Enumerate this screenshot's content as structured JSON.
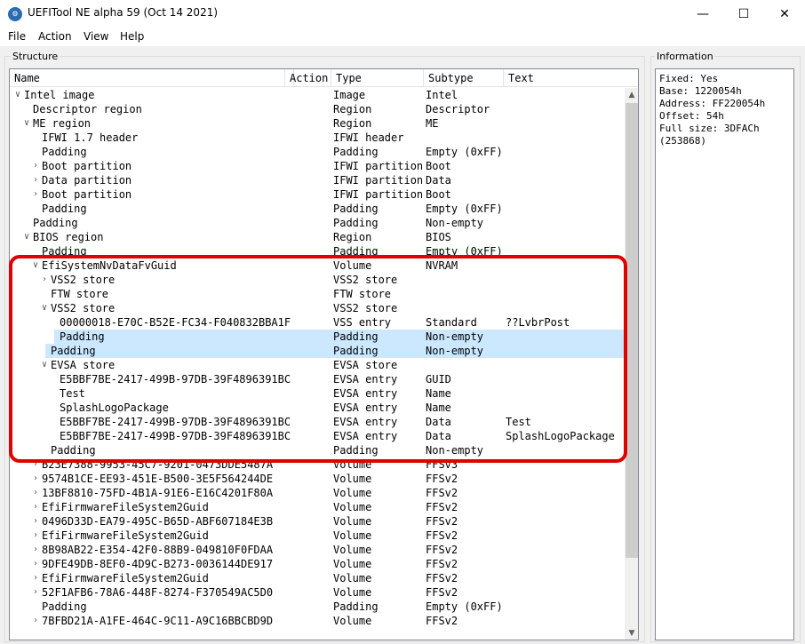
{
  "window": {
    "title": "UEFITool NE alpha 59 (Oct 14 2021)",
    "app_icon_glyph": "⚙",
    "minimize_glyph": "—",
    "maximize_glyph": "☐",
    "close_glyph": "✕"
  },
  "menu": [
    "File",
    "Action",
    "View",
    "Help"
  ],
  "structure": {
    "label": "Structure",
    "columns": [
      "Name",
      "Action",
      "Type",
      "Subtype",
      "Text"
    ],
    "rows": [
      {
        "name": "Intel image",
        "action": "",
        "type": "Image",
        "subtype": "Intel",
        "text": "",
        "depth": 0,
        "expander": "v",
        "selected": false
      },
      {
        "name": "Descriptor region",
        "action": "",
        "type": "Region",
        "subtype": "Descriptor",
        "text": "",
        "depth": 1,
        "expander": "",
        "selected": false
      },
      {
        "name": "ME region",
        "action": "",
        "type": "Region",
        "subtype": "ME",
        "text": "",
        "depth": 1,
        "expander": "v",
        "selected": false
      },
      {
        "name": "IFWI 1.7 header",
        "action": "",
        "type": "IFWI header",
        "subtype": "",
        "text": "",
        "depth": 2,
        "expander": "",
        "selected": false
      },
      {
        "name": "Padding",
        "action": "",
        "type": "Padding",
        "subtype": "Empty (0xFF)",
        "text": "",
        "depth": 2,
        "expander": "",
        "selected": false
      },
      {
        "name": "Boot partition",
        "action": "",
        "type": "IFWI partition",
        "subtype": "Boot",
        "text": "",
        "depth": 2,
        "expander": ">",
        "selected": false
      },
      {
        "name": "Data partition",
        "action": "",
        "type": "IFWI partition",
        "subtype": "Data",
        "text": "",
        "depth": 2,
        "expander": ">",
        "selected": false
      },
      {
        "name": "Boot partition",
        "action": "",
        "type": "IFWI partition",
        "subtype": "Boot",
        "text": "",
        "depth": 2,
        "expander": ">",
        "selected": false
      },
      {
        "name": "Padding",
        "action": "",
        "type": "Padding",
        "subtype": "Empty (0xFF)",
        "text": "",
        "depth": 2,
        "expander": "",
        "selected": false
      },
      {
        "name": "Padding",
        "action": "",
        "type": "Padding",
        "subtype": "Non-empty",
        "text": "",
        "depth": 1,
        "expander": "",
        "selected": false
      },
      {
        "name": "BIOS region",
        "action": "",
        "type": "Region",
        "subtype": "BIOS",
        "text": "",
        "depth": 1,
        "expander": "v",
        "selected": false
      },
      {
        "name": "Padding",
        "action": "",
        "type": "Padding",
        "subtype": "Empty (0xFF)",
        "text": "",
        "depth": 2,
        "expander": "",
        "selected": false
      },
      {
        "name": "EfiSystemNvDataFvGuid",
        "action": "",
        "type": "Volume",
        "subtype": "NVRAM",
        "text": "",
        "depth": 2,
        "expander": "v",
        "selected": false
      },
      {
        "name": "VSS2 store",
        "action": "",
        "type": "VSS2 store",
        "subtype": "",
        "text": "",
        "depth": 3,
        "expander": ">",
        "selected": false
      },
      {
        "name": "FTW store",
        "action": "",
        "type": "FTW store",
        "subtype": "",
        "text": "",
        "depth": 3,
        "expander": "",
        "selected": false
      },
      {
        "name": "VSS2 store",
        "action": "",
        "type": "VSS2 store",
        "subtype": "",
        "text": "",
        "depth": 3,
        "expander": "v",
        "selected": false
      },
      {
        "name": "00000018-E70C-B52E-FC34-F040832BBA1F",
        "action": "",
        "type": "VSS entry",
        "subtype": "Standard",
        "text": "??LvbrPost",
        "depth": 4,
        "expander": "",
        "selected": false
      },
      {
        "name": "Padding",
        "action": "",
        "type": "Padding",
        "subtype": "Non-empty",
        "text": "",
        "depth": 4,
        "expander": "",
        "selected": true
      },
      {
        "name": "Padding",
        "action": "",
        "type": "Padding",
        "subtype": "Non-empty",
        "text": "",
        "depth": 3,
        "expander": "",
        "selected": true
      },
      {
        "name": "EVSA store",
        "action": "",
        "type": "EVSA store",
        "subtype": "",
        "text": "",
        "depth": 3,
        "expander": "v",
        "selected": false
      },
      {
        "name": "E5BBF7BE-2417-499B-97DB-39F4896391BC",
        "action": "",
        "type": "EVSA entry",
        "subtype": "GUID",
        "text": "",
        "depth": 4,
        "expander": "",
        "selected": false
      },
      {
        "name": "Test",
        "action": "",
        "type": "EVSA entry",
        "subtype": "Name",
        "text": "",
        "depth": 4,
        "expander": "",
        "selected": false
      },
      {
        "name": "SplashLogoPackage",
        "action": "",
        "type": "EVSA entry",
        "subtype": "Name",
        "text": "",
        "depth": 4,
        "expander": "",
        "selected": false
      },
      {
        "name": "E5BBF7BE-2417-499B-97DB-39F4896391BC",
        "action": "",
        "type": "EVSA entry",
        "subtype": "Data",
        "text": "Test",
        "depth": 4,
        "expander": "",
        "selected": false
      },
      {
        "name": "E5BBF7BE-2417-499B-97DB-39F4896391BC",
        "action": "",
        "type": "EVSA entry",
        "subtype": "Data",
        "text": "SplashLogoPackage",
        "depth": 4,
        "expander": "",
        "selected": false
      },
      {
        "name": "Padding",
        "action": "",
        "type": "Padding",
        "subtype": "Non-empty",
        "text": "",
        "depth": 3,
        "expander": "",
        "selected": false
      },
      {
        "name": "B23E7388-9953-45C7-9201-0473DDE5487A",
        "action": "",
        "type": "Volume",
        "subtype": "FFSv3",
        "text": "",
        "depth": 2,
        "expander": ">",
        "selected": false
      },
      {
        "name": "9574B1CE-EE93-451E-B500-3E5F564244DE",
        "action": "",
        "type": "Volume",
        "subtype": "FFSv2",
        "text": "",
        "depth": 2,
        "expander": ">",
        "selected": false
      },
      {
        "name": "13BF8810-75FD-4B1A-91E6-E16C4201F80A",
        "action": "",
        "type": "Volume",
        "subtype": "FFSv2",
        "text": "",
        "depth": 2,
        "expander": ">",
        "selected": false
      },
      {
        "name": "EfiFirmwareFileSystem2Guid",
        "action": "",
        "type": "Volume",
        "subtype": "FFSv2",
        "text": "",
        "depth": 2,
        "expander": ">",
        "selected": false
      },
      {
        "name": "0496D33D-EA79-495C-B65D-ABF607184E3B",
        "action": "",
        "type": "Volume",
        "subtype": "FFSv2",
        "text": "",
        "depth": 2,
        "expander": ">",
        "selected": false
      },
      {
        "name": "EfiFirmwareFileSystem2Guid",
        "action": "",
        "type": "Volume",
        "subtype": "FFSv2",
        "text": "",
        "depth": 2,
        "expander": ">",
        "selected": false
      },
      {
        "name": "8B98AB22-E354-42F0-88B9-049810F0FDAA",
        "action": "",
        "type": "Volume",
        "subtype": "FFSv2",
        "text": "",
        "depth": 2,
        "expander": ">",
        "selected": false
      },
      {
        "name": "9DFE49DB-8EF0-4D9C-B273-0036144DE917",
        "action": "",
        "type": "Volume",
        "subtype": "FFSv2",
        "text": "",
        "depth": 2,
        "expander": ">",
        "selected": false
      },
      {
        "name": "EfiFirmwareFileSystem2Guid",
        "action": "",
        "type": "Volume",
        "subtype": "FFSv2",
        "text": "",
        "depth": 2,
        "expander": ">",
        "selected": false
      },
      {
        "name": "52F1AFB6-78A6-448F-8274-F370549AC5D0",
        "action": "",
        "type": "Volume",
        "subtype": "FFSv2",
        "text": "",
        "depth": 2,
        "expander": ">",
        "selected": false
      },
      {
        "name": "Padding",
        "action": "",
        "type": "Padding",
        "subtype": "Empty (0xFF)",
        "text": "",
        "depth": 2,
        "expander": "",
        "selected": false
      },
      {
        "name": "7BFBD21A-A1FE-464C-9C11-A9C16BBCBD9D",
        "action": "",
        "type": "Volume",
        "subtype": "FFSv2",
        "text": "",
        "depth": 2,
        "expander": ">",
        "selected": false
      }
    ]
  },
  "information": {
    "label": "Information",
    "text": "Fixed: Yes\nBase: 1220054h\nAddress: FF220054h\nOffset: 54h\nFull size: 3DFACh\n(253868)"
  },
  "colors": {
    "selection": "#cce8ff",
    "highlight_border": "#e00000"
  }
}
